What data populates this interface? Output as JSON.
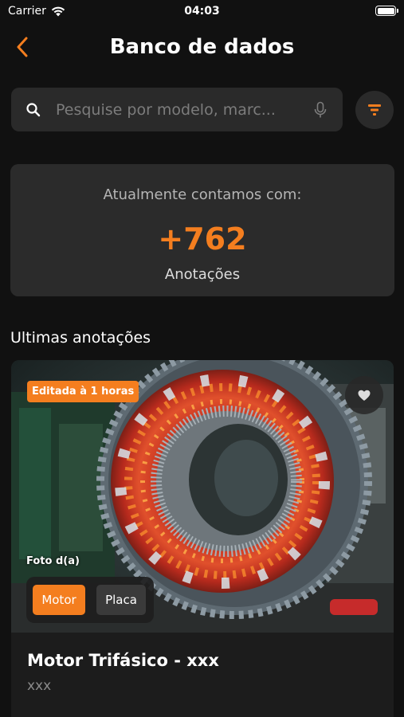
{
  "status_bar": {
    "carrier": "Carrier",
    "time": "04:03",
    "wifi_icon": "wifi-icon",
    "battery_icon": "battery-icon"
  },
  "header": {
    "title": "Banco de dados",
    "back_icon": "chevron-left-icon"
  },
  "search": {
    "placeholder": "Pesquise por modelo, marc...",
    "value": "",
    "search_icon": "search-icon",
    "mic_icon": "mic-icon"
  },
  "filter": {
    "icon": "filter-icon"
  },
  "stats": {
    "caption": "Atualmente contamos com:",
    "count": "+762",
    "label": "Anotações"
  },
  "latest": {
    "section_title": "Ultimas anotações",
    "items": [
      {
        "badge": "Editada à 1 horas",
        "photo_caption": "Foto d(a)",
        "tabs": [
          {
            "label": "Motor",
            "active": true
          },
          {
            "label": "Placa",
            "active": false
          }
        ],
        "title": "Motor Trifásico - xxx",
        "subtitle": "xxx",
        "favorite_icon": "heart-icon"
      }
    ]
  },
  "colors": {
    "accent": "#f47e1f",
    "background": "#111111",
    "surface": "#2b2b2b"
  }
}
